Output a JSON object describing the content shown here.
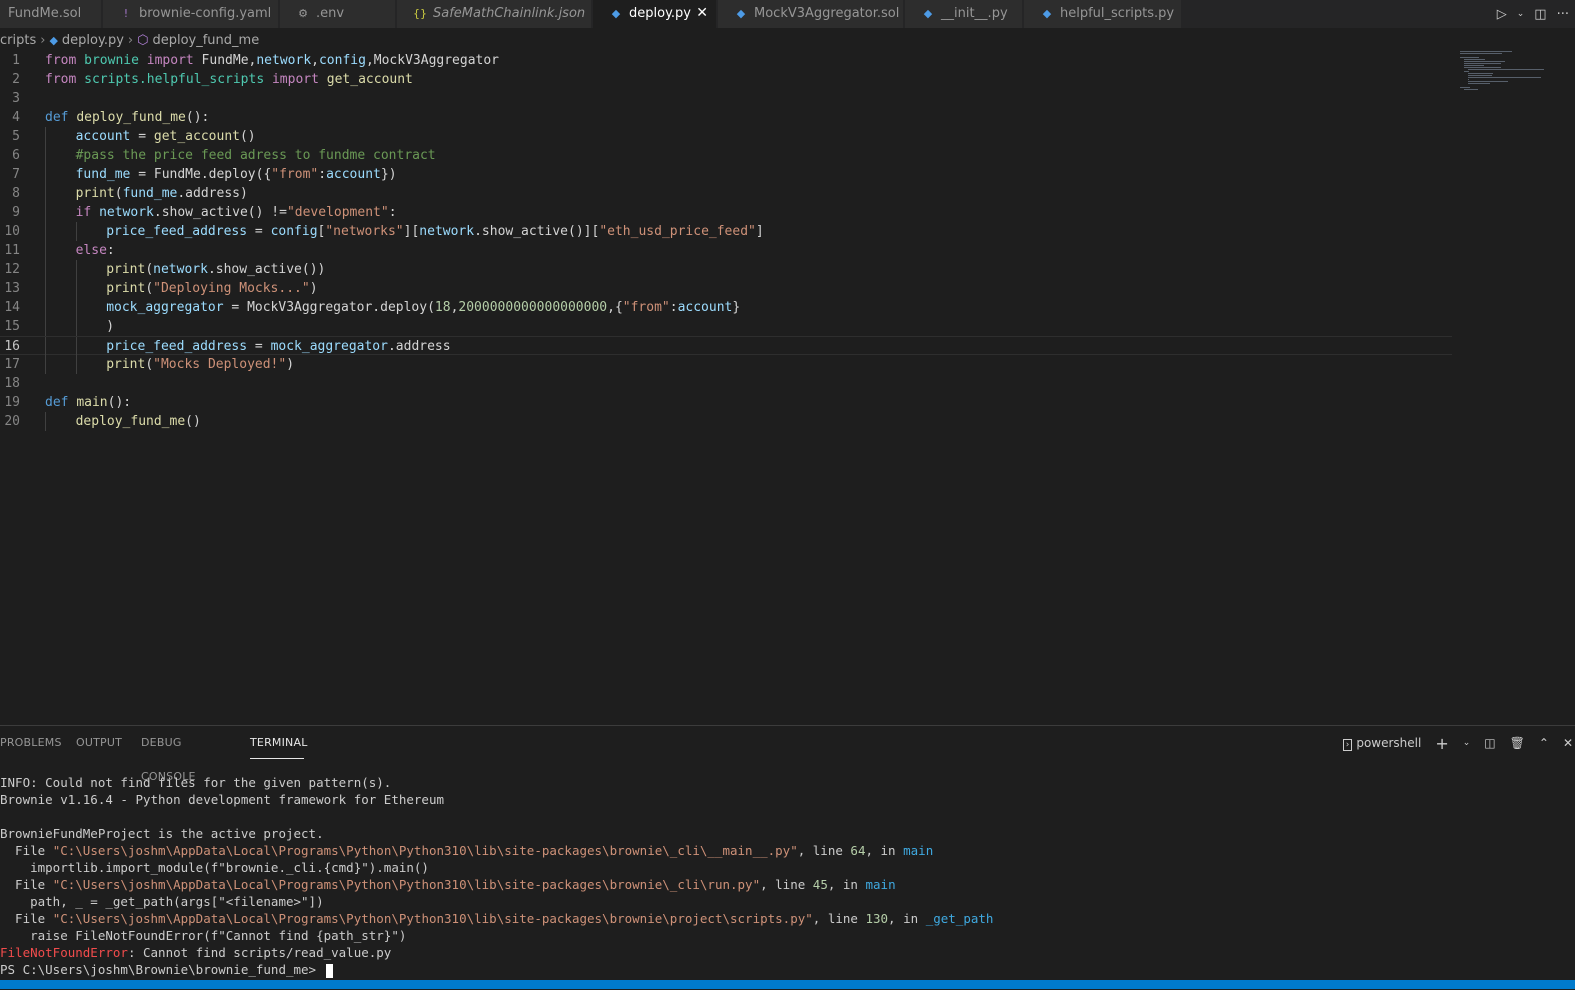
{
  "tabs": [
    {
      "label": "FundMe.sol",
      "icon": "",
      "icon_name": "solidity-file-icon",
      "italic": false,
      "active": false
    },
    {
      "label": "brownie-config.yaml",
      "icon": "!",
      "icon_name": "yaml-file-icon",
      "italic": false,
      "active": false
    },
    {
      "label": ".env",
      "icon": "⚙",
      "icon_name": "gear-icon",
      "italic": false,
      "active": false
    },
    {
      "label": "SafeMathChainlink.json",
      "icon": "{}",
      "icon_name": "json-file-icon",
      "italic": true,
      "active": false
    },
    {
      "label": "deploy.py",
      "icon": "◆",
      "icon_name": "python-file-icon",
      "italic": false,
      "active": true
    },
    {
      "label": "MockV3Aggregator.sol",
      "icon": "◆",
      "icon_name": "solidity-file-icon",
      "italic": false,
      "active": false
    },
    {
      "label": "__init__.py",
      "icon": "◆",
      "icon_name": "python-file-icon",
      "italic": false,
      "active": false
    },
    {
      "label": "helpful_scripts.py",
      "icon": "◆",
      "icon_name": "python-file-icon",
      "italic": false,
      "active": false
    }
  ],
  "breadcrumb": {
    "folder": "cripts",
    "file": "deploy.py",
    "symbol": "deploy_fund_me"
  },
  "editor": {
    "current_line": 16,
    "lines": [
      {
        "n": "1",
        "indent": 0,
        "tokens": [
          [
            "kw2",
            "from"
          ],
          [
            "p",
            " "
          ],
          [
            "mod",
            "brownie"
          ],
          [
            "p",
            " "
          ],
          [
            "kw2",
            "import"
          ],
          [
            "p",
            " FundMe,"
          ],
          [
            "var",
            "network"
          ],
          [
            "p",
            ","
          ],
          [
            "var",
            "config"
          ],
          [
            "p",
            ",MockV3Aggregator"
          ]
        ]
      },
      {
        "n": "2",
        "indent": 0,
        "tokens": [
          [
            "kw2",
            "from"
          ],
          [
            "p",
            " "
          ],
          [
            "mod",
            "scripts.helpful_scripts"
          ],
          [
            "p",
            " "
          ],
          [
            "kw2",
            "import"
          ],
          [
            "p",
            " "
          ],
          [
            "fn",
            "get_account"
          ]
        ]
      },
      {
        "n": "3",
        "indent": 0,
        "tokens": []
      },
      {
        "n": "4",
        "indent": 0,
        "tokens": [
          [
            "kw",
            "def"
          ],
          [
            "p",
            " "
          ],
          [
            "fn",
            "deploy_fund_me"
          ],
          [
            "p",
            "():"
          ]
        ]
      },
      {
        "n": "5",
        "indent": 1,
        "tokens": [
          [
            "var",
            "account"
          ],
          [
            "p",
            " = "
          ],
          [
            "fn",
            "get_account"
          ],
          [
            "p",
            "()"
          ]
        ]
      },
      {
        "n": "6",
        "indent": 1,
        "tokens": [
          [
            "com",
            "#pass the price feed adress to fundme contract"
          ]
        ]
      },
      {
        "n": "7",
        "indent": 1,
        "tokens": [
          [
            "var",
            "fund_me"
          ],
          [
            "p",
            " = FundMe.deploy({"
          ],
          [
            "str",
            "\"from\""
          ],
          [
            "p",
            ":"
          ],
          [
            "var",
            "account"
          ],
          [
            "p",
            "})"
          ]
        ]
      },
      {
        "n": "8",
        "indent": 1,
        "tokens": [
          [
            "fn",
            "print"
          ],
          [
            "p",
            "("
          ],
          [
            "var",
            "fund_me"
          ],
          [
            "p",
            ".address)"
          ]
        ]
      },
      {
        "n": "9",
        "indent": 1,
        "tokens": [
          [
            "kw2",
            "if"
          ],
          [
            "p",
            " "
          ],
          [
            "var",
            "network"
          ],
          [
            "p",
            ".show_active() !="
          ],
          [
            "str",
            "\"development\""
          ],
          [
            "p",
            ":"
          ]
        ]
      },
      {
        "n": "10",
        "indent": 2,
        "tokens": [
          [
            "var",
            "price_feed_address"
          ],
          [
            "p",
            " = "
          ],
          [
            "var",
            "config"
          ],
          [
            "p",
            "["
          ],
          [
            "str",
            "\"networks\""
          ],
          [
            "p",
            "]["
          ],
          [
            "var",
            "network"
          ],
          [
            "p",
            ".show_active()]["
          ],
          [
            "str",
            "\"eth_usd_price_feed\""
          ],
          [
            "p",
            "]"
          ]
        ]
      },
      {
        "n": "11",
        "indent": 1,
        "tokens": [
          [
            "kw2",
            "else"
          ],
          [
            "p",
            ":"
          ]
        ]
      },
      {
        "n": "12",
        "indent": 2,
        "tokens": [
          [
            "fn",
            "print"
          ],
          [
            "p",
            "("
          ],
          [
            "var",
            "network"
          ],
          [
            "p",
            ".show_active())"
          ]
        ]
      },
      {
        "n": "13",
        "indent": 2,
        "tokens": [
          [
            "fn",
            "print"
          ],
          [
            "p",
            "("
          ],
          [
            "str",
            "\"Deploying Mocks...\""
          ],
          [
            "p",
            ")"
          ]
        ]
      },
      {
        "n": "14",
        "indent": 2,
        "tokens": [
          [
            "var",
            "mock_aggregator"
          ],
          [
            "p",
            " = MockV3Aggregator.deploy("
          ],
          [
            "num",
            "18"
          ],
          [
            "p",
            ","
          ],
          [
            "num",
            "2000000000000000000"
          ],
          [
            "p",
            ",{"
          ],
          [
            "str",
            "\"from\""
          ],
          [
            "p",
            ":"
          ],
          [
            "var",
            "account"
          ],
          [
            "p",
            "}"
          ]
        ]
      },
      {
        "n": "15",
        "indent": 2,
        "tokens": [
          [
            "p",
            ")"
          ]
        ]
      },
      {
        "n": "16",
        "indent": 2,
        "tokens": [
          [
            "var",
            "price_feed_address"
          ],
          [
            "p",
            " = "
          ],
          [
            "var",
            "mock_aggregator"
          ],
          [
            "p",
            ".address"
          ]
        ]
      },
      {
        "n": "17",
        "indent": 2,
        "tokens": [
          [
            "fn",
            "print"
          ],
          [
            "p",
            "("
          ],
          [
            "str",
            "\"Mocks Deployed!\""
          ],
          [
            "p",
            ")"
          ]
        ]
      },
      {
        "n": "18",
        "indent": 0,
        "tokens": []
      },
      {
        "n": "19",
        "indent": 0,
        "tokens": [
          [
            "kw",
            "def"
          ],
          [
            "p",
            " "
          ],
          [
            "fn",
            "main"
          ],
          [
            "p",
            "():"
          ]
        ]
      },
      {
        "n": "20",
        "indent": 1,
        "tokens": [
          [
            "fn",
            "deploy_fund_me"
          ],
          [
            "p",
            "()"
          ]
        ]
      }
    ]
  },
  "panel": {
    "tabs": [
      {
        "label": "PROBLEMS",
        "active": false
      },
      {
        "label": "OUTPUT",
        "active": false
      },
      {
        "label": "DEBUG CONSOLE",
        "active": false
      },
      {
        "label": "TERMINAL",
        "active": true
      }
    ],
    "shell_label": "powershell",
    "terminal_lines": [
      [
        [
          "p",
          "INFO: Could not find files for the given pattern(s)."
        ]
      ],
      [
        [
          "p",
          "Brownie v1.16.4 - Python development framework for Ethereum"
        ]
      ],
      [],
      [
        [
          "p",
          "BrownieFundMeProject is the active project."
        ]
      ],
      [
        [
          "p",
          "  File "
        ],
        [
          "path",
          "\"C:\\Users\\joshm\\AppData\\Local\\Programs\\Python\\Python310\\lib\\site-packages\\brownie\\_cli\\__main__.py\""
        ],
        [
          "p",
          ", line "
        ],
        [
          "num",
          "64"
        ],
        [
          "p",
          ", in "
        ],
        [
          "fn",
          "main"
        ]
      ],
      [
        [
          "p",
          "    importlib.import_module(f\"brownie._cli.{cmd}\").main()"
        ]
      ],
      [
        [
          "p",
          "  File "
        ],
        [
          "path",
          "\"C:\\Users\\joshm\\AppData\\Local\\Programs\\Python\\Python310\\lib\\site-packages\\brownie\\_cli\\run.py\""
        ],
        [
          "p",
          ", line "
        ],
        [
          "num",
          "45"
        ],
        [
          "p",
          ", in "
        ],
        [
          "fn",
          "main"
        ]
      ],
      [
        [
          "p",
          "    path, _ = _get_path(args[\"<filename>\"])"
        ]
      ],
      [
        [
          "p",
          "  File "
        ],
        [
          "path",
          "\"C:\\Users\\joshm\\AppData\\Local\\Programs\\Python\\Python310\\lib\\site-packages\\brownie\\project\\scripts.py\""
        ],
        [
          "p",
          ", line "
        ],
        [
          "num",
          "130"
        ],
        [
          "p",
          ", in "
        ],
        [
          "fn",
          "_get_path"
        ]
      ],
      [
        [
          "p",
          "    raise FileNotFoundError(f\"Cannot find {path_str}\")"
        ]
      ],
      [
        [
          "err",
          "FileNotFoundError"
        ],
        [
          "p",
          ": Cannot find scripts/read_value.py"
        ]
      ],
      [
        [
          "p",
          "PS C:\\Users\\joshm\\Brownie\\brownie_fund_me> "
        ]
      ]
    ]
  },
  "colors": {
    "accent": "#007acc",
    "editor_bg": "#1e1e1e",
    "tab_bg": "#2d2d2d"
  }
}
